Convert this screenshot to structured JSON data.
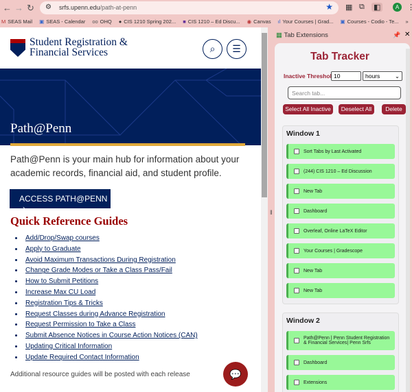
{
  "browser": {
    "url_host": "srfs.upenn.edu",
    "url_path": "/path-at-penn",
    "profile_initial": "A",
    "bookmarks": [
      "SEAS Mail",
      "SEAS - Calendar",
      "OHQ",
      "CIS 1210 Spring 202...",
      "CIS 1210 – Ed Discu...",
      "Canvas",
      "Your Courses | Grad...",
      "Courses - Codio - Te..."
    ]
  },
  "site": {
    "brand_line1": "Student Registration &",
    "brand_line2": "Financial Services",
    "banner_title": "Path@Penn",
    "intro": "Path@Penn is your main hub for information about your academic records, financial aid, and student profile.",
    "access_button": "ACCESS PATH@PENN",
    "section_title": "Quick Reference Guides",
    "links": [
      "Add/Drop/Swap courses",
      "Apply to Graduate",
      "Avoid Maximum Transactions During Registration",
      "Change Grade Modes or Take a Class Pass/Fail",
      "How to Submit Petitions",
      "Increase Max CU Load",
      "Registration Tips & Tricks",
      "Request Classes during Advance Registration",
      "Request Permission to Take a Class",
      "Submit Absence Notices in Course Action Notices (CAN)",
      "Updating Critical Information",
      "Update Required Contact Information"
    ],
    "footer": "Additional resource guides will be posted with each release"
  },
  "panel": {
    "header": "Tab Extensions",
    "title": "Tab Tracker",
    "threshold_label": "Inactive Threshold:",
    "threshold_value": "10",
    "threshold_unit": "hours",
    "search_placeholder": "Search tab...",
    "buttons": {
      "select_all": "Select All Inactive",
      "deselect_all": "Deselect All",
      "delete": "Delete"
    },
    "windows": [
      {
        "name": "Window 1",
        "tabs": [
          "Sort Tabs by Last Activated",
          "(244) CIS 1210 – Ed Discussion",
          "New Tab",
          "Dashboard",
          "Overleaf, Online LaTeX Editor",
          "Your Courses | Gradescope",
          "New Tab",
          "New Tab"
        ]
      },
      {
        "name": "Window 2",
        "tabs": [
          "Path@Penn | Penn Student Registration & Financial Services| Penn Srfs",
          "Dashboard",
          "Extensions"
        ]
      }
    ]
  }
}
